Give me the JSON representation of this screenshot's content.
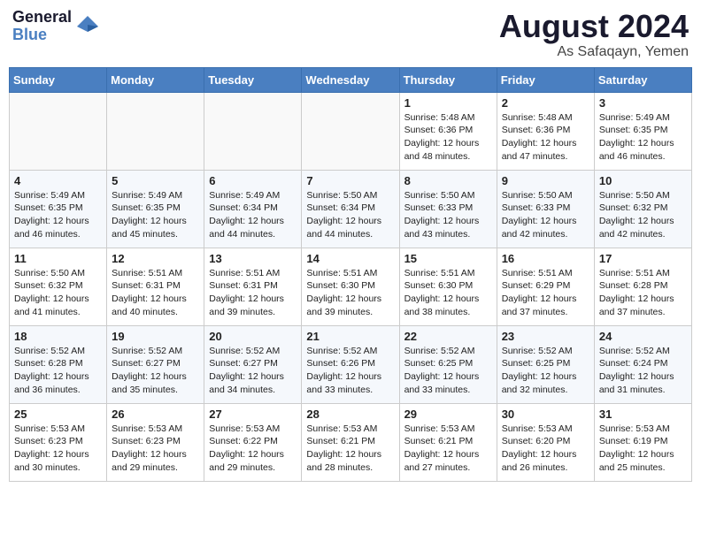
{
  "header": {
    "logo_line1": "General",
    "logo_line2": "Blue",
    "month": "August 2024",
    "location": "As Safaqayn, Yemen"
  },
  "days_of_week": [
    "Sunday",
    "Monday",
    "Tuesday",
    "Wednesday",
    "Thursday",
    "Friday",
    "Saturday"
  ],
  "weeks": [
    [
      {
        "day": "",
        "info": ""
      },
      {
        "day": "",
        "info": ""
      },
      {
        "day": "",
        "info": ""
      },
      {
        "day": "",
        "info": ""
      },
      {
        "day": "1",
        "info": "Sunrise: 5:48 AM\nSunset: 6:36 PM\nDaylight: 12 hours\nand 48 minutes."
      },
      {
        "day": "2",
        "info": "Sunrise: 5:48 AM\nSunset: 6:36 PM\nDaylight: 12 hours\nand 47 minutes."
      },
      {
        "day": "3",
        "info": "Sunrise: 5:49 AM\nSunset: 6:35 PM\nDaylight: 12 hours\nand 46 minutes."
      }
    ],
    [
      {
        "day": "4",
        "info": "Sunrise: 5:49 AM\nSunset: 6:35 PM\nDaylight: 12 hours\nand 46 minutes."
      },
      {
        "day": "5",
        "info": "Sunrise: 5:49 AM\nSunset: 6:35 PM\nDaylight: 12 hours\nand 45 minutes."
      },
      {
        "day": "6",
        "info": "Sunrise: 5:49 AM\nSunset: 6:34 PM\nDaylight: 12 hours\nand 44 minutes."
      },
      {
        "day": "7",
        "info": "Sunrise: 5:50 AM\nSunset: 6:34 PM\nDaylight: 12 hours\nand 44 minutes."
      },
      {
        "day": "8",
        "info": "Sunrise: 5:50 AM\nSunset: 6:33 PM\nDaylight: 12 hours\nand 43 minutes."
      },
      {
        "day": "9",
        "info": "Sunrise: 5:50 AM\nSunset: 6:33 PM\nDaylight: 12 hours\nand 42 minutes."
      },
      {
        "day": "10",
        "info": "Sunrise: 5:50 AM\nSunset: 6:32 PM\nDaylight: 12 hours\nand 42 minutes."
      }
    ],
    [
      {
        "day": "11",
        "info": "Sunrise: 5:50 AM\nSunset: 6:32 PM\nDaylight: 12 hours\nand 41 minutes."
      },
      {
        "day": "12",
        "info": "Sunrise: 5:51 AM\nSunset: 6:31 PM\nDaylight: 12 hours\nand 40 minutes."
      },
      {
        "day": "13",
        "info": "Sunrise: 5:51 AM\nSunset: 6:31 PM\nDaylight: 12 hours\nand 39 minutes."
      },
      {
        "day": "14",
        "info": "Sunrise: 5:51 AM\nSunset: 6:30 PM\nDaylight: 12 hours\nand 39 minutes."
      },
      {
        "day": "15",
        "info": "Sunrise: 5:51 AM\nSunset: 6:30 PM\nDaylight: 12 hours\nand 38 minutes."
      },
      {
        "day": "16",
        "info": "Sunrise: 5:51 AM\nSunset: 6:29 PM\nDaylight: 12 hours\nand 37 minutes."
      },
      {
        "day": "17",
        "info": "Sunrise: 5:51 AM\nSunset: 6:28 PM\nDaylight: 12 hours\nand 37 minutes."
      }
    ],
    [
      {
        "day": "18",
        "info": "Sunrise: 5:52 AM\nSunset: 6:28 PM\nDaylight: 12 hours\nand 36 minutes."
      },
      {
        "day": "19",
        "info": "Sunrise: 5:52 AM\nSunset: 6:27 PM\nDaylight: 12 hours\nand 35 minutes."
      },
      {
        "day": "20",
        "info": "Sunrise: 5:52 AM\nSunset: 6:27 PM\nDaylight: 12 hours\nand 34 minutes."
      },
      {
        "day": "21",
        "info": "Sunrise: 5:52 AM\nSunset: 6:26 PM\nDaylight: 12 hours\nand 33 minutes."
      },
      {
        "day": "22",
        "info": "Sunrise: 5:52 AM\nSunset: 6:25 PM\nDaylight: 12 hours\nand 33 minutes."
      },
      {
        "day": "23",
        "info": "Sunrise: 5:52 AM\nSunset: 6:25 PM\nDaylight: 12 hours\nand 32 minutes."
      },
      {
        "day": "24",
        "info": "Sunrise: 5:52 AM\nSunset: 6:24 PM\nDaylight: 12 hours\nand 31 minutes."
      }
    ],
    [
      {
        "day": "25",
        "info": "Sunrise: 5:53 AM\nSunset: 6:23 PM\nDaylight: 12 hours\nand 30 minutes."
      },
      {
        "day": "26",
        "info": "Sunrise: 5:53 AM\nSunset: 6:23 PM\nDaylight: 12 hours\nand 29 minutes."
      },
      {
        "day": "27",
        "info": "Sunrise: 5:53 AM\nSunset: 6:22 PM\nDaylight: 12 hours\nand 29 minutes."
      },
      {
        "day": "28",
        "info": "Sunrise: 5:53 AM\nSunset: 6:21 PM\nDaylight: 12 hours\nand 28 minutes."
      },
      {
        "day": "29",
        "info": "Sunrise: 5:53 AM\nSunset: 6:21 PM\nDaylight: 12 hours\nand 27 minutes."
      },
      {
        "day": "30",
        "info": "Sunrise: 5:53 AM\nSunset: 6:20 PM\nDaylight: 12 hours\nand 26 minutes."
      },
      {
        "day": "31",
        "info": "Sunrise: 5:53 AM\nSunset: 6:19 PM\nDaylight: 12 hours\nand 25 minutes."
      }
    ]
  ]
}
